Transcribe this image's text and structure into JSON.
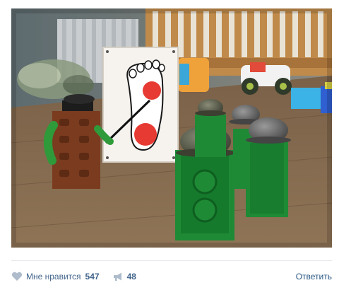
{
  "post": {
    "photo_alt": "",
    "actions": {
      "like_label": "Мне нравится",
      "like_count": "547",
      "share_count": "48",
      "reply_label": "Ответить"
    },
    "icons": {
      "like": "heart-icon",
      "share": "megaphone-icon"
    },
    "colors": {
      "link": "#2a5885",
      "action_text": "#42648b",
      "icon": "#aebccb",
      "divider": "#e7e8ec"
    }
  }
}
